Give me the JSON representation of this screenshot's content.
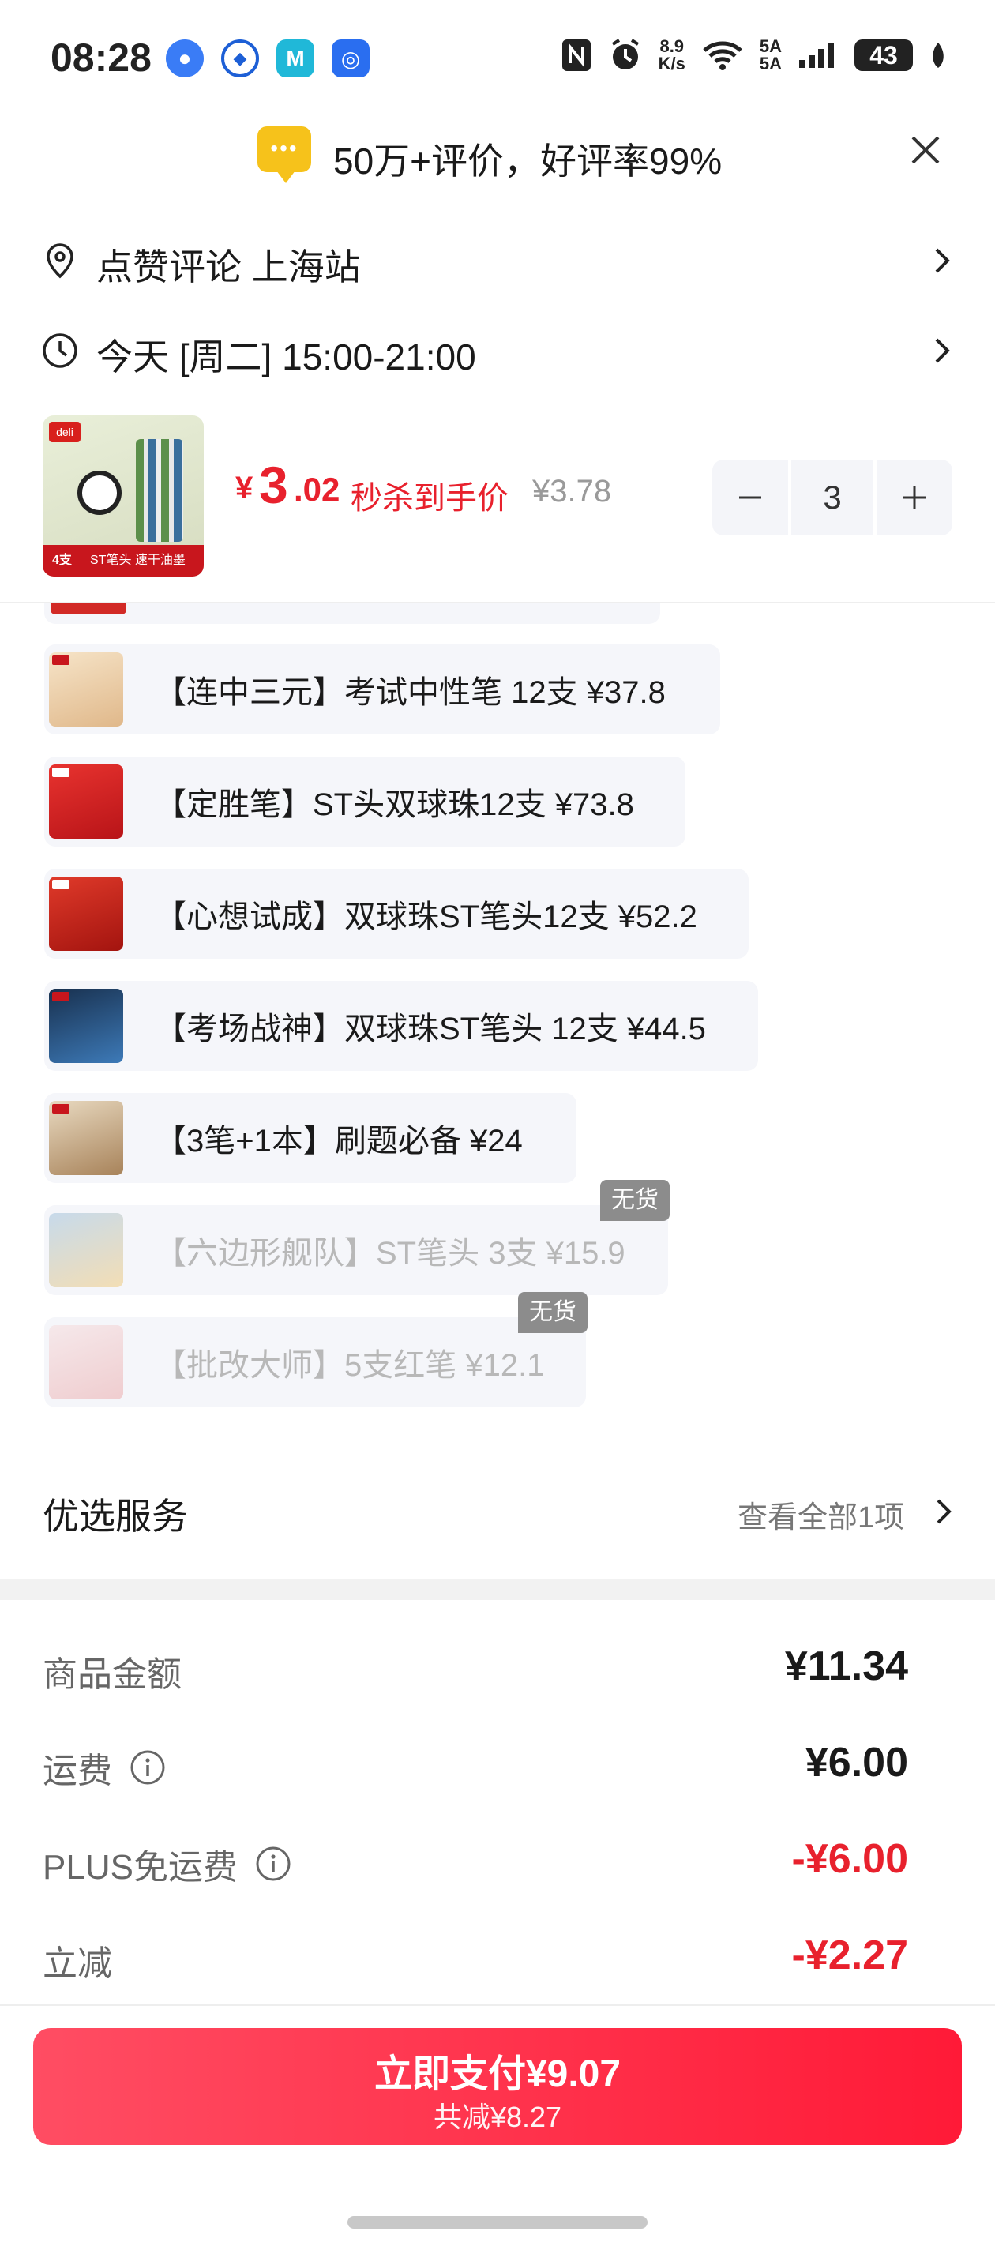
{
  "status_bar": {
    "time": "08:28",
    "net_speed_value": "8.9",
    "net_speed_unit": "K/s",
    "sim_top": "5A",
    "sim_bottom": "5A",
    "battery": "43"
  },
  "banner": {
    "text": "50万+评价，好评率99%"
  },
  "address": {
    "text": "点赞评论 上海站"
  },
  "delivery": {
    "text": "今天 [周二] 15:00-21:00"
  },
  "product": {
    "currency": "¥",
    "price_int": "3",
    "price_dec": ".02",
    "seckill_label": "秒杀到手价",
    "old_price": "¥3.78",
    "quantity": "3",
    "thumb_band_text": "ST笔头 速干油墨",
    "thumb_count": "4支"
  },
  "bundles": [
    {
      "text": "【连中三元】考试中性笔 12支   ¥37.8",
      "available": true
    },
    {
      "text": "【定胜笔】ST头双球珠12支   ¥73.8",
      "available": true
    },
    {
      "text": "【心想试成】双球珠ST笔头12支   ¥52.2",
      "available": true
    },
    {
      "text": "【考场战神】双球珠ST笔头 12支   ¥44.5",
      "available": true
    },
    {
      "text": "【3笔+1本】刷题必备   ¥24",
      "available": true
    },
    {
      "text": "【六边形舰队】ST笔头 3支   ¥15.9",
      "available": false
    },
    {
      "text": "【批改大师】5支红笔   ¥12.1",
      "available": false
    }
  ],
  "soldout_label": "无货",
  "services": {
    "title": "优选服务",
    "link": "查看全部1项"
  },
  "summary": {
    "goods_label": "商品金额",
    "goods_value": "¥11.34",
    "shipping_label": "运费",
    "shipping_value": "¥6.00",
    "plus_label": "PLUS免运费",
    "plus_value": "-¥6.00",
    "discount_label": "立减",
    "discount_value": "-¥2.27"
  },
  "pay": {
    "main": "立即支付¥9.07",
    "sub": "共减¥8.27"
  },
  "colors": {
    "accent_red": "#e8212d",
    "pay_gradient_start": "#ff4d63",
    "pay_gradient_end": "#ff1a37",
    "banner_icon": "#f6c21b"
  },
  "icons": {
    "banner": "message-dots-icon",
    "close": "close-icon",
    "address": "location-pin-icon",
    "delivery": "clock-icon",
    "chevron": "chevron-right-icon",
    "info": "info-icon"
  }
}
